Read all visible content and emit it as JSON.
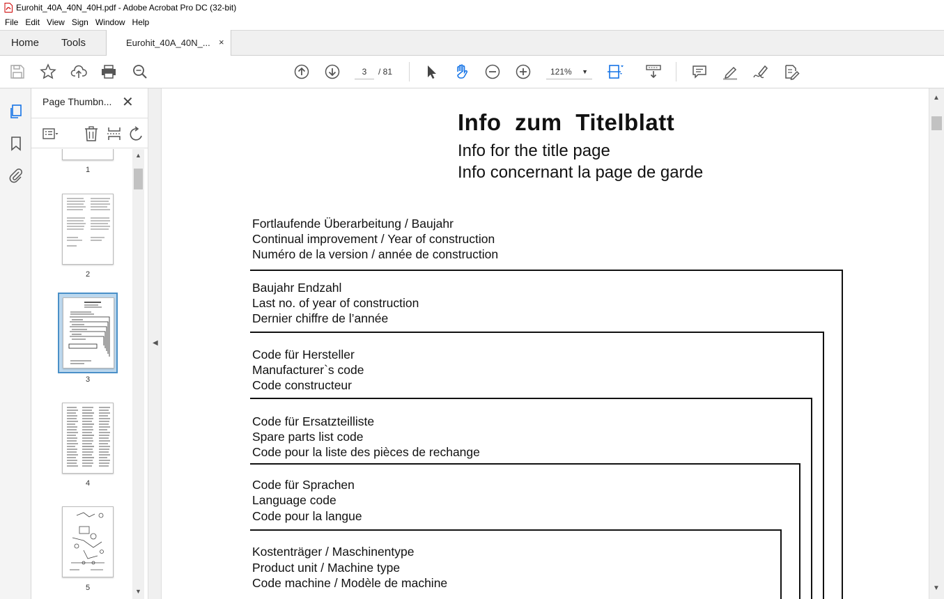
{
  "window": {
    "title": "Eurohit_40A_40N_40H.pdf - Adobe Acrobat Pro DC (32-bit)"
  },
  "menu": [
    "File",
    "Edit",
    "View",
    "Sign",
    "Window",
    "Help"
  ],
  "tabs": {
    "home": "Home",
    "tools": "Tools",
    "document": "Eurohit_40A_40N_...",
    "close": "×"
  },
  "toolbar": {
    "page_current": "3",
    "page_total": "/ 81",
    "zoom": "121%",
    "zoom_caret": "▼",
    "icons": [
      "save-icon",
      "star-icon",
      "upload-icon",
      "print-icon",
      "search-zoom-icon",
      "page-up-icon",
      "page-down-icon",
      "select-arrow-icon",
      "hand-icon",
      "zoom-out-icon",
      "zoom-in-icon",
      "fit-page-icon",
      "scroll-mode-icon",
      "comment-icon",
      "highlight-icon",
      "sign-icon",
      "edit-icon"
    ]
  },
  "panel": {
    "title": "Page Thumbn...",
    "close": "✕",
    "thumbnails": [
      {
        "num": "1"
      },
      {
        "num": "2"
      },
      {
        "num": "3",
        "selected": true
      },
      {
        "num": "4"
      },
      {
        "num": "5"
      }
    ]
  },
  "document": {
    "title": "Info  zum  Titelblatt",
    "subtitle_en": "Info for the title page",
    "subtitle_fr": "Info concernant la page de garde",
    "blocks": [
      {
        "de": "Fortlaufende Überarbeitung / Baujahr",
        "en": "Continual improvement / Year of construction",
        "fr": "Numéro de la version / année de construction"
      },
      {
        "de": "Baujahr Endzahl",
        "en": "Last no. of year of construction",
        "fr": "Dernier chiffre de l’année"
      },
      {
        "de": "Code für Hersteller",
        "en": "Manufacturer`s  code",
        "fr": "Code constructeur"
      },
      {
        "de": "Code für Ersatzteilliste",
        "en": "Spare parts list code",
        "fr": "Code pour la liste des pièces de rechange"
      },
      {
        "de": "Code für Sprachen",
        "en": "Language code",
        "fr": "Code pour la langue"
      },
      {
        "de": "Kostenträger / Maschinentype",
        "en": "Product unit / Machine type",
        "fr": "Code machine / Modèle de machine"
      }
    ]
  },
  "colors": {
    "accent": "#1473e6",
    "selection": "#bcd8ee",
    "selection_border": "#4a90c8"
  }
}
